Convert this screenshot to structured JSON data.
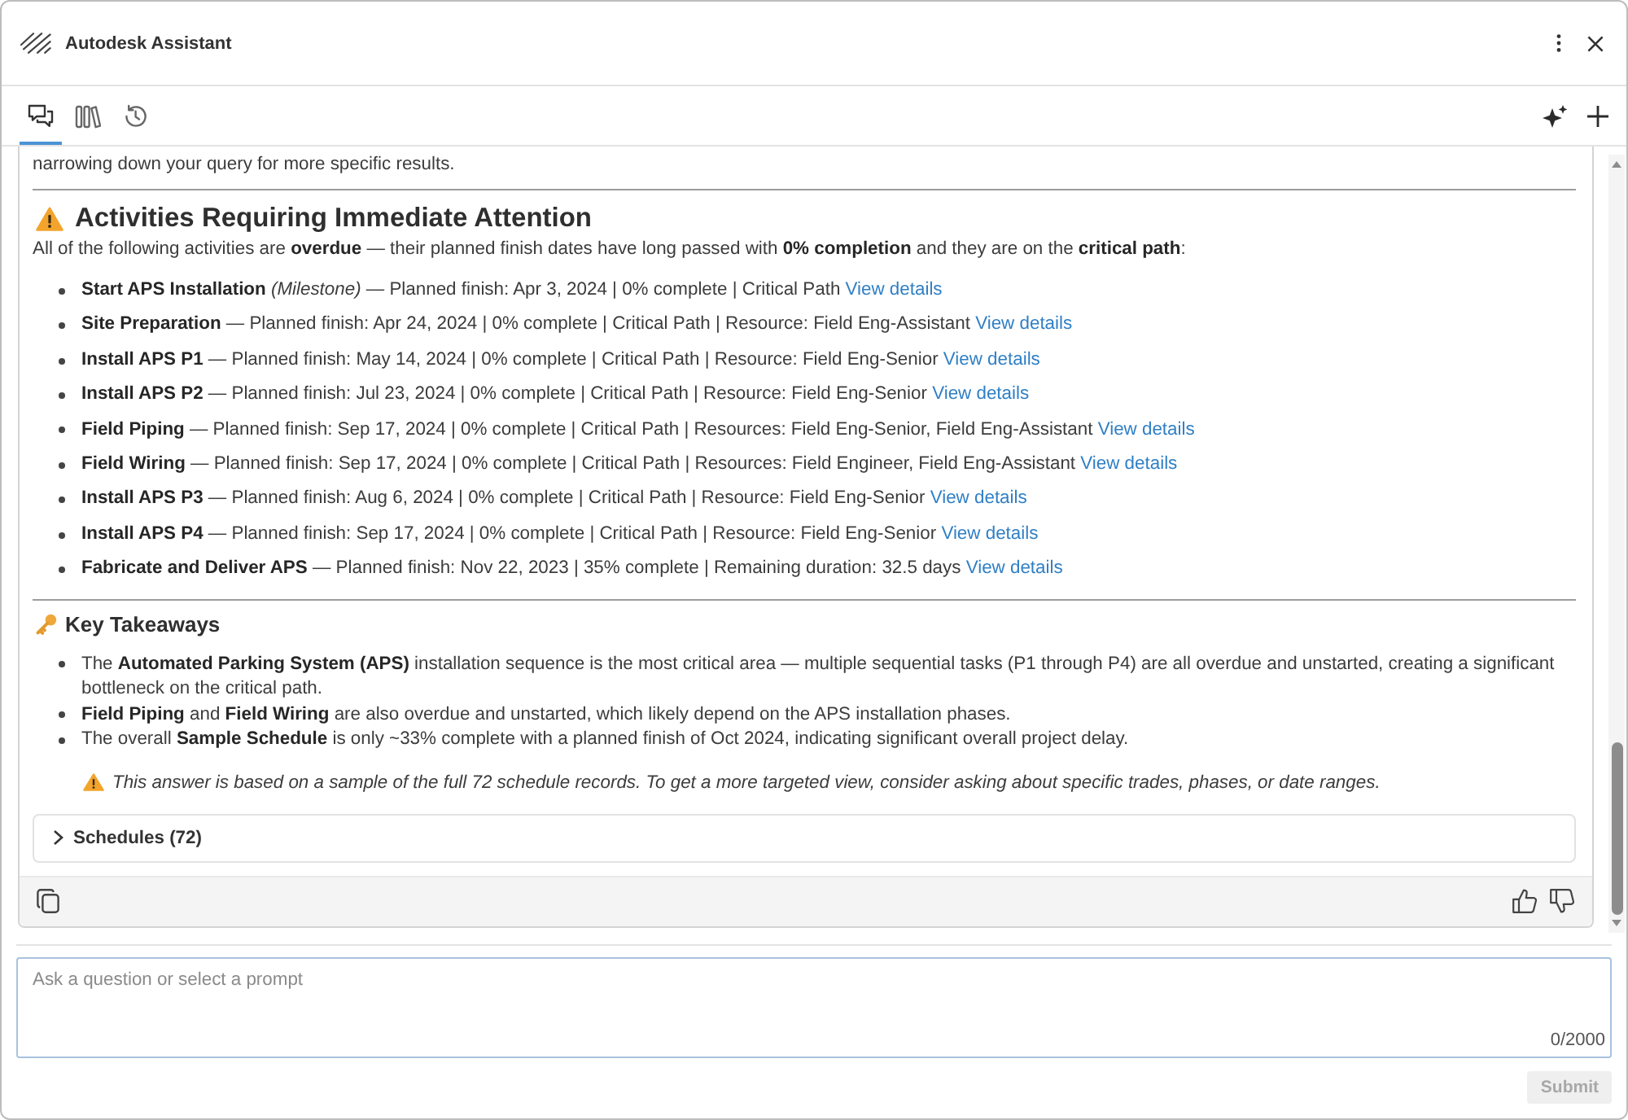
{
  "window": {
    "title": "Autodesk Assistant"
  },
  "tabs": [
    {
      "kind": "chat",
      "selected": true
    },
    {
      "kind": "library",
      "selected": false
    },
    {
      "kind": "history",
      "selected": false
    }
  ],
  "message": {
    "lead_text": "narrowing down your query for more specific results.",
    "attention": {
      "heading": "Activities Requiring Immediate Attention",
      "intro": "All of the following activities are **overdue** — their planned finish dates have long passed with **0% completion** and they are on the **critical path**:",
      "items": [
        {
          "text": "**Start APS Installation** *(Milestone)* — Planned finish: Apr 3, 2024 | 0% complete | Critical Path",
          "link": "View details"
        },
        {
          "text": "**Site Preparation** — Planned finish: Apr 24, 2024 | 0% complete | Critical Path | Resource: Field Eng-Assistant",
          "link": "View details"
        },
        {
          "text": "**Install APS P1** — Planned finish: May 14, 2024 | 0% complete | Critical Path | Resource: Field Eng-Senior",
          "link": "View details"
        },
        {
          "text": "**Install APS P2** — Planned finish: Jul 23, 2024 | 0% complete | Critical Path | Resource: Field Eng-Senior",
          "link": "View details"
        },
        {
          "text": "**Field Piping** — Planned finish: Sep 17, 2024 | 0% complete | Critical Path | Resources: Field Eng-Senior, Field Eng-Assistant",
          "link": "View details"
        },
        {
          "text": "**Field Wiring** — Planned finish: Sep 17, 2024 | 0% complete | Critical Path | Resources: Field Engineer, Field Eng-Assistant",
          "link": "View details"
        },
        {
          "text": "**Install APS P3** — Planned finish: Aug 6, 2024 | 0% complete | Critical Path | Resource: Field Eng-Senior",
          "link": "View details"
        },
        {
          "text": "**Install APS P4** — Planned finish: Sep 17, 2024 | 0% complete | Critical Path | Resource: Field Eng-Senior",
          "link": "View details"
        },
        {
          "text": "**Fabricate and Deliver APS** — Planned finish: Nov 22, 2023 | 35% complete | Remaining duration: 32.5 days",
          "link": "View details"
        }
      ]
    },
    "takeaways": {
      "heading": "Key Takeaways",
      "items": [
        "The **Automated Parking System (APS)** installation sequence is the most critical area — multiple sequential tasks (P1 through P4) are all overdue and unstarted, creating a significant bottleneck on the critical path.",
        "**Field Piping** and **Field Wiring** are also overdue and unstarted, which likely depend on the APS installation phases.",
        "The overall **Sample Schedule** is only ~33% complete with a planned finish of Oct 2024, indicating significant overall project delay."
      ]
    },
    "notice": "This answer is based on a sample of the full 72 schedule records. To get a more targeted view, consider asking about specific trades, phases, or date ranges.",
    "sources": {
      "label": "Schedules (72)",
      "expanded": false
    }
  },
  "composer": {
    "placeholder": "Ask a question or select a prompt",
    "counter": "0/2000",
    "submit": {
      "label": "Submit",
      "disabled": true
    }
  }
}
